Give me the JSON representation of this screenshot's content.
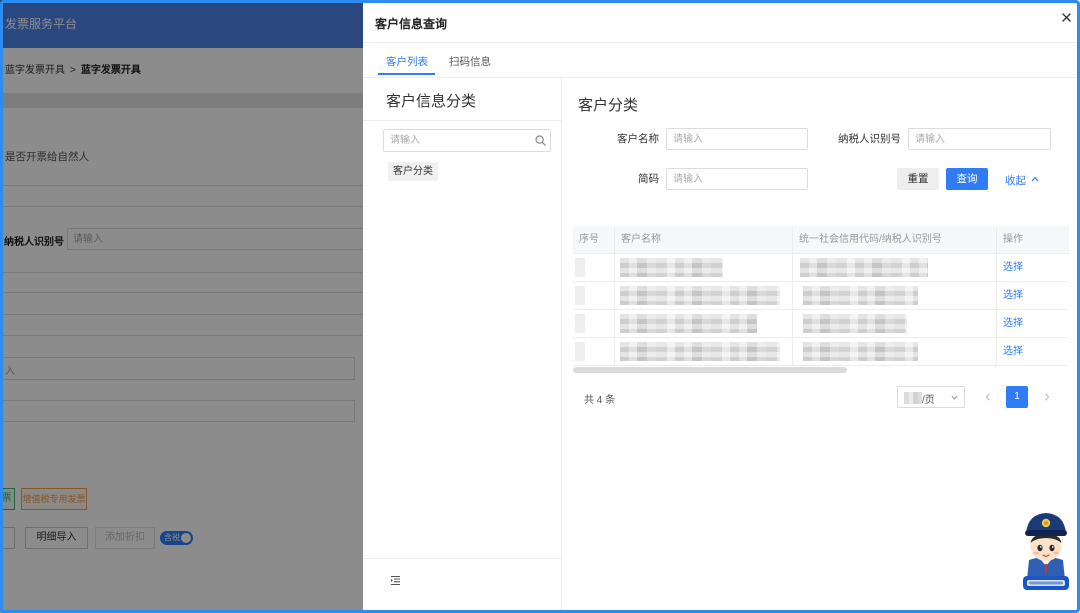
{
  "background_page": {
    "platform_title": "发票服务平台",
    "breadcrumb": {
      "parent": "蓝字发票开具",
      "separator": ">",
      "current": "蓝字发票开具"
    },
    "natural_person_label": "是否开票给自然人",
    "taxpayer_id": {
      "label": "纳税人识别号",
      "placeholder": "请输入"
    },
    "cut_input_text": "入",
    "invoice_types": [
      {
        "label": "票"
      },
      {
        "label": "增值税专用发票"
      }
    ],
    "actions": {
      "import_label": "明细导入",
      "discount_label": "添加折扣",
      "tax_toggle_label": "含税",
      "tax_toggle_on": true
    }
  },
  "drawer": {
    "title": "客户信息查询",
    "tabs": [
      {
        "label": "客户列表",
        "active": true
      },
      {
        "label": "扫码信息",
        "active": false
      }
    ],
    "category": {
      "heading": "客户信息分类",
      "search_placeholder": "请输入",
      "tree": [
        {
          "label": "客户分类",
          "selected": true
        }
      ]
    },
    "main": {
      "heading": "客户分类",
      "filters": {
        "customer_name": {
          "label": "客户名称",
          "value": "",
          "placeholder": "请输入"
        },
        "taxpayer_id": {
          "label": "纳税人识别号",
          "value": "",
          "placeholder": "请输入"
        },
        "short_code": {
          "label": "简码",
          "value": "",
          "placeholder": "请输入"
        }
      },
      "buttons": {
        "reset": "重置",
        "query": "查询",
        "collapse": "收起"
      },
      "table": {
        "columns": [
          "序号",
          "客户名称",
          "统一社会信用代码/纳税人识别号",
          "操作"
        ],
        "rows": [
          {
            "redacted": true,
            "action": "选择"
          },
          {
            "redacted": true,
            "action": "选择"
          },
          {
            "redacted": true,
            "action": "选择"
          },
          {
            "redacted": true,
            "action": "选择"
          }
        ]
      },
      "pagination": {
        "total": "共 4 条",
        "page_size_suffix": "/页",
        "current_page": "1"
      }
    }
  },
  "icons": {
    "close": "close-icon",
    "search": "search-icon",
    "collapse": "chevron-up-icon",
    "page_size_dropdown": "chevron-down-icon",
    "prev_page": "chevron-left-icon",
    "next_page": "chevron-right-icon",
    "category_fold": "menu-fold-icon",
    "mascot": "tax-officer-mascot-icon"
  },
  "colors": {
    "accent": "#2f7cf6",
    "frame_border": "#2b8df2",
    "platform_header": "#4f82e8",
    "normal_invoice_tag": "#3cb878",
    "special_invoice_tag": "#f0a050",
    "mask": "rgba(0,0,0,0.45)"
  }
}
